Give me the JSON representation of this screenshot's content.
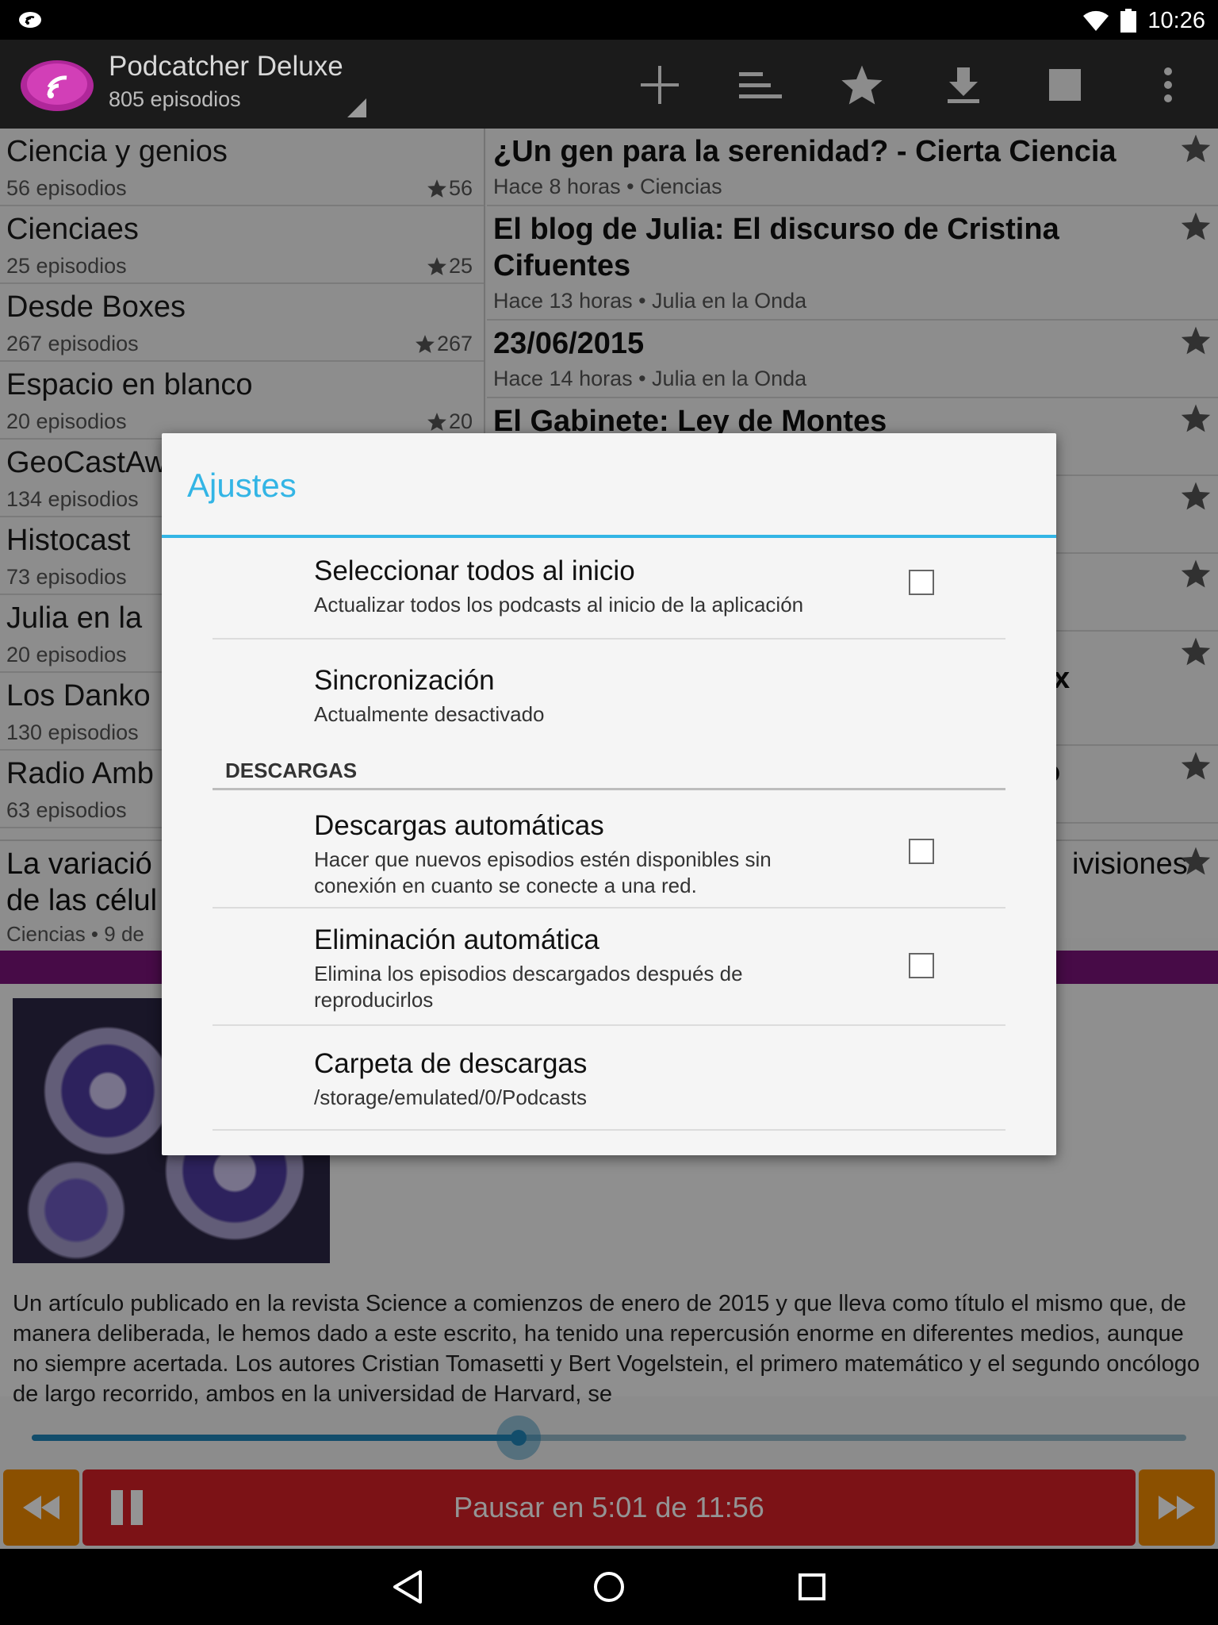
{
  "status_bar": {
    "time": "10:26"
  },
  "app_bar": {
    "title": "Podcatcher Deluxe",
    "subtitle": "805 episodios",
    "actions": [
      "add-icon",
      "sort-icon",
      "star-icon",
      "download-icon",
      "stop-icon",
      "overflow-menu-icon"
    ]
  },
  "feeds": [
    {
      "title": "Ciencia y genios",
      "count": "56 episodios",
      "stars": "56"
    },
    {
      "title": "Cienciaes",
      "count": "25 episodios",
      "stars": "25"
    },
    {
      "title": "Desde Boxes",
      "count": "267 episodios",
      "stars": "267"
    },
    {
      "title": "Espacio en blanco",
      "count": "20 episodios",
      "stars": "20"
    },
    {
      "title": "GeoCastAw",
      "count": "134 episodios",
      "stars": ""
    },
    {
      "title": "Histocast",
      "count": "73 episodios",
      "stars": ""
    },
    {
      "title": "Julia en la",
      "count": "20 episodios",
      "stars": ""
    },
    {
      "title": "Los Danko",
      "count": "130 episodios",
      "stars": ""
    },
    {
      "title": "Radio Amb",
      "count": "63 episodios",
      "stars": ""
    }
  ],
  "episodes": [
    {
      "title": "¿Un gen para la serenidad? - Cierta Ciencia",
      "meta": "Hace 8 horas • Ciencias"
    },
    {
      "title": "El blog de Julia: El discurso de Cristina Cifuentes",
      "meta": "Hace 13 horas • Julia en la Onda"
    },
    {
      "title": "23/06/2015",
      "meta": "Hace 14 horas • Julia en la Onda"
    },
    {
      "title": "El Gabinete: Ley de Montes",
      "meta": ""
    },
    {
      "title": "",
      "meta": ""
    },
    {
      "title": "",
      "meta": ""
    },
    {
      "title": "x",
      "meta": ""
    },
    {
      "title": "o",
      "meta": ""
    }
  ],
  "now_playing": {
    "title_start": "La variació",
    "title_end": "ivisiones",
    "title_line2": "de las célul",
    "meta": "Ciencias • 9 de",
    "description": "Un artículo publicado en la revista Science a comienzos de enero de 2015 y que lleva como título el mismo que, de manera deliberada, le hemos dado a este escrito, ha tenido una repercusión enorme en diferentes medios, aunque no siempre acertada. Los autores Cristian Tomasetti y Bert Vogelstein, el primero matemático y el segundo oncólogo de largo recorrido, ambos en la universidad de Harvard, se",
    "progress": 0.4216,
    "play_label": "Pausar en 5:01 de 11:56"
  },
  "dialog": {
    "title": "Ajustes",
    "prefs_top": [
      {
        "title": "Seleccionar todos al inicio",
        "summary": "Actualizar todos los podcasts al inicio de la aplicación",
        "checked": false
      },
      {
        "title": "Sincronización",
        "summary": "Actualmente desactivado"
      }
    ],
    "category": "DESCARGAS",
    "prefs_downloads": [
      {
        "title": "Descargas automáticas",
        "summary": "Hacer que nuevos episodios estén disponibles sin conexión en cuanto se conecte a una red.",
        "checked": false
      },
      {
        "title": "Eliminación automática",
        "summary": "Elimina los episodios descargados después de reproducirlos",
        "checked": false
      },
      {
        "title": "Carpeta de descargas",
        "summary": "/storage/emulated/0/Podcasts"
      }
    ]
  },
  "colors": {
    "accent": "#33b5e5",
    "purple": "#7a147a",
    "orange": "#f08a00",
    "red": "#d61f26",
    "seek": "#1f86b8"
  }
}
